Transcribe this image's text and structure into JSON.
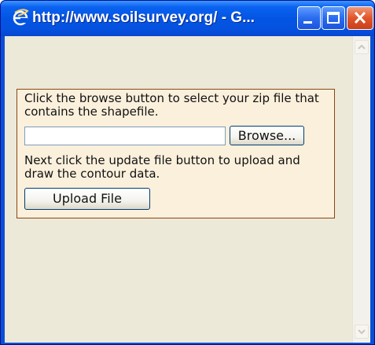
{
  "window": {
    "title": "http://www.soilsurvey.org/ - G..."
  },
  "upload_panel": {
    "instruction_1": "Click the browse button to select your zip file that contains the shapefile.",
    "file_input_value": "",
    "browse_label": "Browse...",
    "instruction_2": "Next click the update file button to upload and draw the contour data.",
    "upload_label": "Upload File"
  },
  "icons": {
    "title": "ie-icon",
    "minimize": "minimize-icon",
    "maximize": "maximize-icon",
    "close": "close-icon",
    "scroll_up": "arrow-up-icon",
    "scroll_down": "arrow-down-icon"
  },
  "colors": {
    "titlebar": "#0454e3",
    "panel_background": "#fbf0dc",
    "panel_border": "#8b4513",
    "window_background": "#ece9d8",
    "close_button": "#e2542a"
  }
}
